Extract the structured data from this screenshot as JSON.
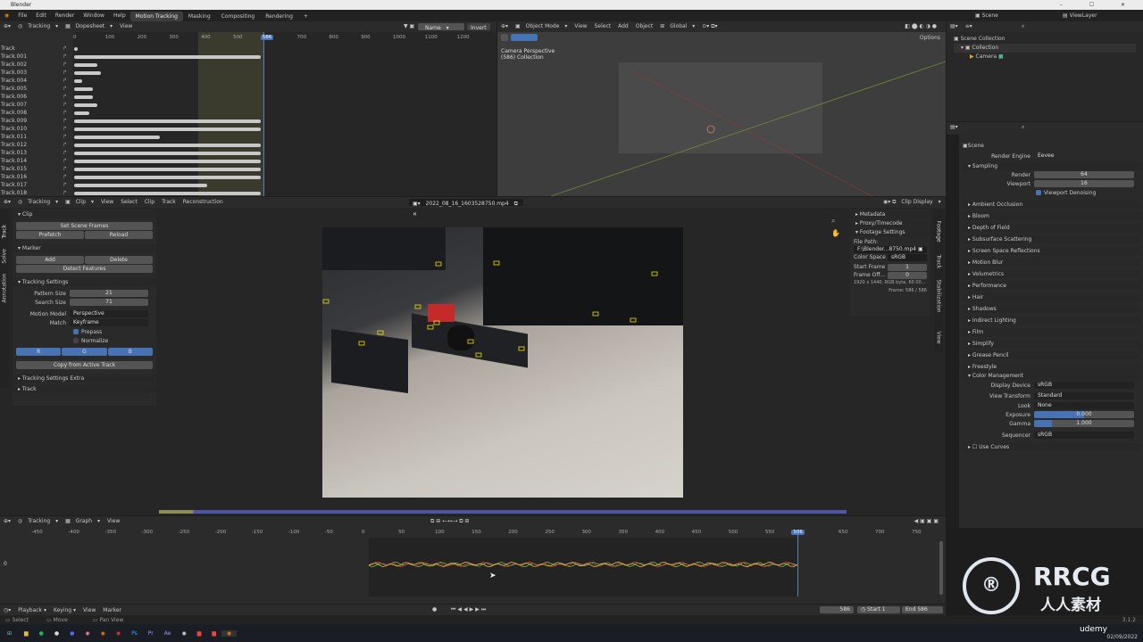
{
  "title": "Blender",
  "window_controls": "–  ☐  ✕",
  "menu": [
    "File",
    "Edit",
    "Render",
    "Window",
    "Help"
  ],
  "workspaces": [
    "Motion Tracking",
    "Masking",
    "Compositing",
    "Rendering",
    "+"
  ],
  "active_workspace": "Motion Tracking",
  "scene": {
    "name": "Scene",
    "view_layer": "ViewLayer"
  },
  "dopesheet": {
    "editor": "Tracking",
    "mode": "Dopesheet",
    "view": "View",
    "sort": "Name",
    "invert": "Invert",
    "frame_marks": [
      "0",
      "100",
      "200",
      "300",
      "400",
      "500",
      "586",
      "700",
      "800",
      "900",
      "1000",
      "1100",
      "1200"
    ],
    "current_frame": "586",
    "tracks": [
      "Track",
      "Track.001",
      "Track.002",
      "Track.003",
      "Track.004",
      "Track.005",
      "Track.006",
      "Track.007",
      "Track.008",
      "Track.009",
      "Track.010",
      "Track.011",
      "Track.012",
      "Track.013",
      "Track.014",
      "Track.015",
      "Track.016",
      "Track.017",
      "Track.018"
    ],
    "track_extent": [
      0.02,
      0.98,
      0.12,
      0.14,
      0.04,
      0.1,
      0.1,
      0.12,
      0.08,
      0.98,
      0.98,
      0.45,
      0.98,
      0.98,
      0.98,
      0.98,
      0.98,
      0.7,
      0.98
    ]
  },
  "viewport": {
    "mode": "Object Mode",
    "menus": [
      "View",
      "Select",
      "Add",
      "Object"
    ],
    "orientation": "Global",
    "options": "Options",
    "info1": "Camera Perspective",
    "info2": "(586) Collection"
  },
  "outliner": {
    "root": "Scene Collection",
    "collection": "Collection",
    "camera": "Camera"
  },
  "clip_editor": {
    "editor": "Tracking",
    "mode": "Clip",
    "menus": [
      "View",
      "Select",
      "Clip",
      "Track",
      "Reconstruction"
    ],
    "clip_name": "2022_08_16_1603528750.mp4",
    "display": "Clip Display"
  },
  "clip_tools": {
    "side_tabs": [
      "Track",
      "Solve",
      "Annotation"
    ],
    "clip_section": "Clip",
    "set_scene_frames": "Set Scene Frames",
    "prefetch": "Prefetch",
    "reload": "Reload",
    "marker_section": "Marker",
    "add": "Add",
    "delete": "Delete",
    "detect": "Detect Features",
    "tracking_settings": "Tracking Settings",
    "pattern_label": "Pattern Size",
    "pattern_value": "21",
    "search_label": "Search Size",
    "search_value": "71",
    "motion_label": "Motion Model",
    "motion_value": "Perspective",
    "match_label": "Match",
    "match_value": "Keyframe",
    "prepass": "Prepass",
    "normalize": "Normalize",
    "r": "R",
    "g": "G",
    "b": "B",
    "copy_active": "Copy from Active Track",
    "extra": "Tracking Settings Extra",
    "track_section": "Track"
  },
  "clip_props": {
    "side_tabs": [
      "Footage",
      "Track",
      "Stabilization",
      "View"
    ],
    "metadata": "Metadata",
    "proxy": "Proxy/Timecode",
    "footage": "Footage Settings",
    "file_path_label": "File Path:",
    "file_path": "F:\\Blender...8750.mp4",
    "color_space_label": "Color Space",
    "color_space": "sRGB",
    "start_frame_label": "Start Frame",
    "start_frame": "1",
    "frame_offset_label": "Frame Off...",
    "frame_offset": "0",
    "info": "1920 x 1440, RGB byte, 60.00...",
    "frame": "Frame: 586 / 586"
  },
  "graph": {
    "editor": "Tracking",
    "mode": "Graph",
    "view": "View",
    "ticks": [
      "-450",
      "-400",
      "-350",
      "-300",
      "-250",
      "-200",
      "-150",
      "-100",
      "-50",
      "0",
      "50",
      "100",
      "150",
      "200",
      "250",
      "300",
      "350",
      "400",
      "450",
      "500",
      "550",
      "586",
      "650",
      "700",
      "750"
    ],
    "y_zero": "0",
    "current": "586"
  },
  "timeline": {
    "menus": [
      "Playback",
      "Keying",
      "View",
      "Marker"
    ],
    "frame": "586",
    "start_label": "Start",
    "start": "1",
    "end_label": "End",
    "end": "586"
  },
  "status": {
    "select": "Select",
    "move": "Move",
    "pan": "Pan View",
    "version": "3.1.2"
  },
  "properties": {
    "scene": "Scene",
    "render_engine_label": "Render Engine",
    "render_engine": "Eevee",
    "sampling": "Sampling",
    "render_label": "Render",
    "render": "64",
    "viewport_label": "Viewport",
    "viewport": "16",
    "denoise": "Viewport Denoising",
    "sections": [
      "Ambient Occlusion",
      "Bloom",
      "Depth of Field",
      "Subsurface Scattering",
      "Screen Space Reflections",
      "Motion Blur",
      "Volumetrics",
      "Performance",
      "Hair",
      "Shadows",
      "Indirect Lighting",
      "Film",
      "Simplify",
      "Grease Pencil",
      "Freestyle"
    ],
    "color_management": "Color Management",
    "display_device_label": "Display Device",
    "display_device": "sRGB",
    "view_transform_label": "View Transform",
    "view_transform": "Standard",
    "look_label": "Look",
    "look": "None",
    "exposure_label": "Exposure",
    "exposure": "0.000",
    "gamma_label": "Gamma",
    "gamma": "1.000",
    "sequencer_label": "Sequencer",
    "sequencer": "sRGB",
    "use_curves": "Use Curves"
  },
  "taskbar": {
    "time": "02/09/2022",
    "udemy": "udemy"
  },
  "watermark": {
    "big": "RRCG",
    "small": "人人素材"
  }
}
